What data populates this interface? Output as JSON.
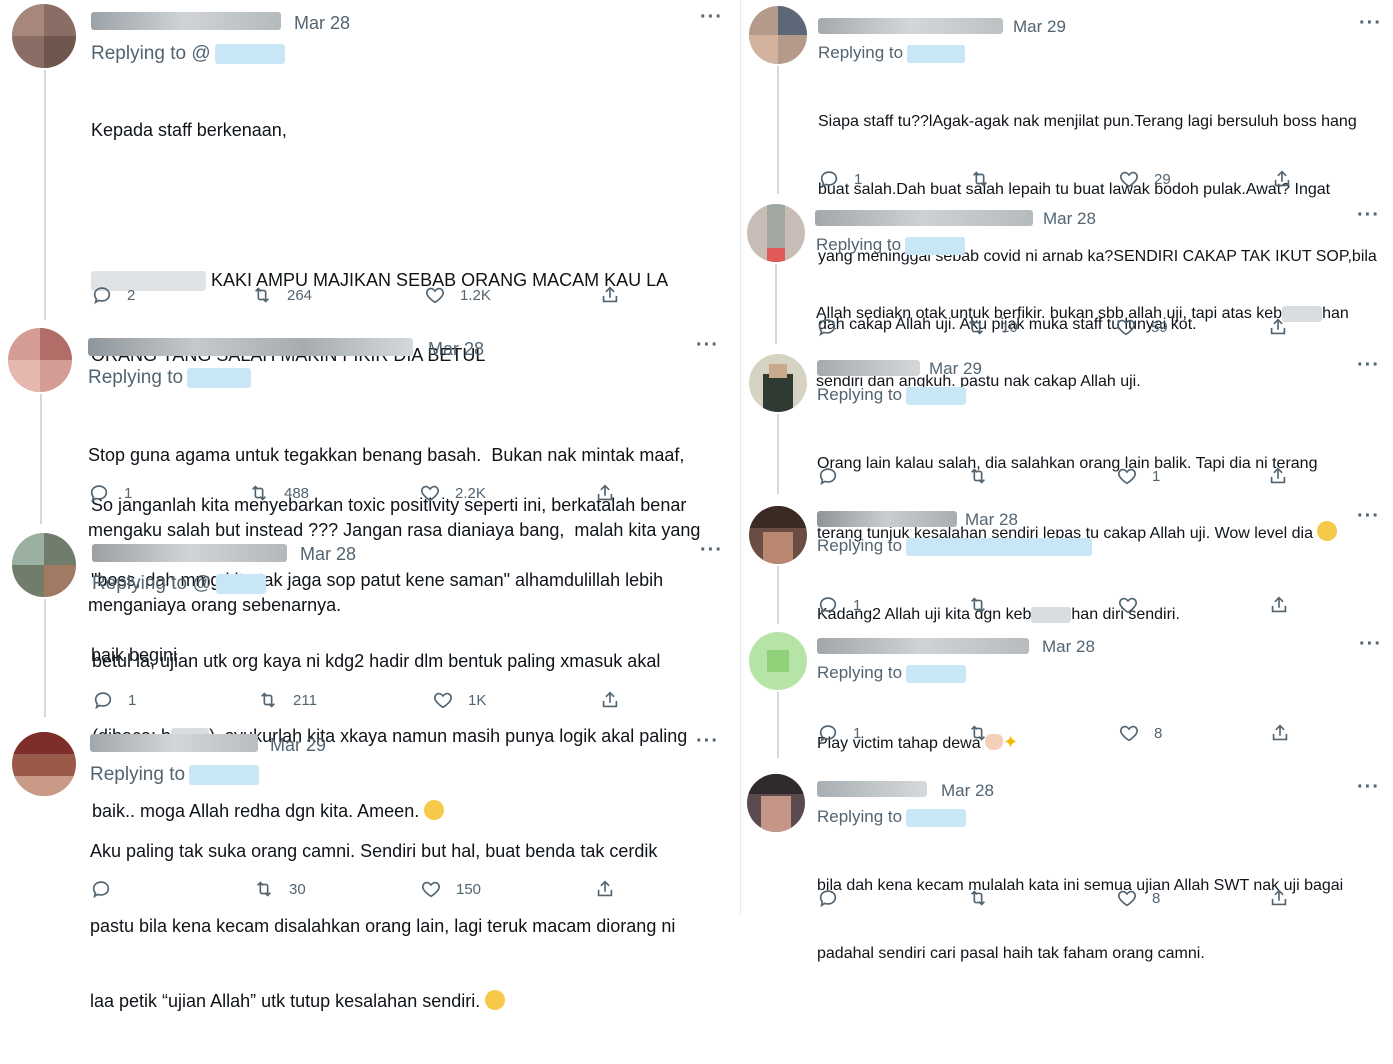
{
  "left": [
    {
      "date": "Mar 28",
      "reply_prefix": "Replying to @",
      "text_lines": [
        "Kepada staff berkenaan,",
        "",
        "",
        "",
        "",
        "So janganlah kita menyebarkan toxic positivity seperti ini, berkatalah benar",
        "\"boss, dah mmg kita tak jaga sop patut kene saman\" alhamdulillah lebih",
        "baik begini"
      ],
      "blur_line_1": "KAKI AMPU MAJIKAN SEBAB ORANG MACAM KAU LA",
      "blur_line_2": "ORANG YANG SALAH MAKIN FIKIR DIA BETUL",
      "replies": "2",
      "retweets": "264",
      "likes": "1.2K"
    },
    {
      "date": "Mar 28",
      "reply_prefix": "Replying to",
      "text_lines": [
        "Stop guna agama untuk tegakkan benang basah.  Bukan nak mintak maaf,",
        "mengaku salah but instead ??? Jangan rasa dianiaya bang,  malah kita yang",
        "menganiaya orang sebenarnya."
      ],
      "replies": "1",
      "retweets": "488",
      "likes": "2.2K"
    },
    {
      "date": "Mar 28",
      "reply_prefix": "Replying to @",
      "line1": "betul la, ujian utk org kaya ni kdg2 hadir dlm bentuk paling xmasuk akal",
      "line2a": "(dibaca; b",
      "line2b": "). syukurlah kita xkaya namun masih punya logik akal paling",
      "line3": "baik.. moga Allah redha dgn kita. Ameen.",
      "replies": "1",
      "retweets": "211",
      "likes": "1K"
    },
    {
      "date": "Mar 29",
      "reply_prefix": "Replying to",
      "text_lines": [
        "Aku paling tak suka orang camni. Sendiri but hal, buat benda tak cerdik",
        "pastu bila kena kecam disalahkan orang lain, lagi teruk macam diorang ni"
      ],
      "line3": "laa petik “ujian Allah” utk tutup kesalahan sendiri.",
      "replies": "",
      "retweets": "30",
      "likes": "150"
    }
  ],
  "right": [
    {
      "date": "Mar 29",
      "reply_prefix": "Replying to",
      "text_lines": [
        "Siapa staff tu??lAgak-agak nak menjilat pun.Terang lagi bersuluh boss hang",
        "buat salah.Dah buat salah lepaih tu buat lawak bodoh pulak.Awat? Ingat",
        "yang meninggai sebab covid ni arnab ka?SENDIRI CAKAP TAK IKUT SOP,bila",
        "dah cakap Allah uji. Aku pijak muka staff tu lunyai kot."
      ],
      "replies": "1",
      "retweets": "",
      "likes": "29"
    },
    {
      "date": "Mar 28",
      "reply_prefix": "Replying to",
      "line1a": "Allah sediakn otak untuk berfikir. bukan sbb allah uji, tapi atas keb",
      "line1b": "han",
      "line2": "sendiri dan angkuh. pastu nak cakap Allah uji.",
      "replies": "",
      "retweets": "10",
      "likes": "59"
    },
    {
      "date": "Mar 29",
      "reply_prefix": "Replying to",
      "line1": "Orang lain kalau salah, dia salahkan orang lain balik. Tapi dia ni terang",
      "line2": "terang tunjuk kesalahan sendiri lepas tu cakap Allah uji. Wow level dia",
      "replies": "",
      "retweets": "",
      "likes": "1"
    },
    {
      "date": "Mar 28",
      "reply_prefix": "Replying to",
      "line1a": "Kadang2 Allah uji kita dgn keb",
      "line1b": "han diri sendiri.",
      "replies": "1",
      "retweets": "",
      "likes": ""
    },
    {
      "date": "Mar 28",
      "reply_prefix": "Replying to",
      "line1": "Play victim tahap dewa",
      "replies": "1",
      "retweets": "",
      "likes": "8"
    },
    {
      "date": "Mar 28",
      "reply_prefix": "Replying to",
      "text_lines": [
        "bila dah kena kecam mulalah kata ini semua ujian Allah SWT nak uji bagai",
        "padahal sendiri cari pasal haih tak faham orang camni."
      ],
      "replies": "",
      "retweets": "",
      "likes": "8"
    }
  ],
  "icons": [
    "reply-icon",
    "retweet-icon",
    "like-icon",
    "share-icon",
    "more-icon"
  ],
  "colors": {
    "muted": "#536471",
    "link": "#1d9bf0",
    "thread": "#cfd9de"
  }
}
